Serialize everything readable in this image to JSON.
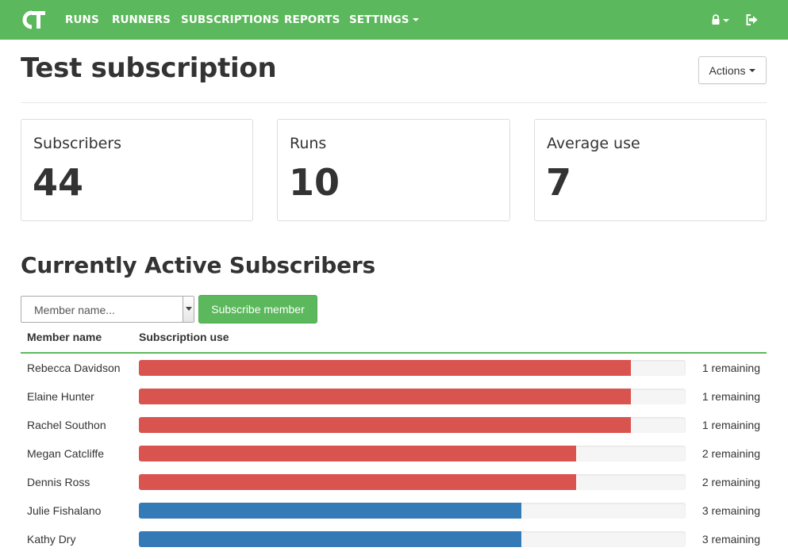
{
  "nav": {
    "items": [
      {
        "label": "RUNS"
      },
      {
        "label": "RUNNERS"
      },
      {
        "label": "SUBSCRIPTIONS"
      },
      {
        "label": "REPORTS"
      },
      {
        "label": "SETTINGS"
      }
    ],
    "accent_color": "#5cb85c",
    "right_icons": [
      "lock-icon",
      "sign-out-icon"
    ]
  },
  "page": {
    "title": "Test subscription",
    "actions_label": "Actions"
  },
  "stats": [
    {
      "label": "Subscribers",
      "value": "44"
    },
    {
      "label": "Runs",
      "value": "10"
    },
    {
      "label": "Average use",
      "value": "7"
    }
  ],
  "section": {
    "title": "Currently Active Subscribers",
    "select_placeholder": "Member name...",
    "subscribe_label": "Subscribe member"
  },
  "table": {
    "headers": [
      "Member name",
      "Subscription use"
    ],
    "colors": {
      "high": "#d9534f",
      "normal": "#337ab7"
    },
    "rows": [
      {
        "name": "Rebecca Davidson",
        "used": 9,
        "total": 10,
        "level": "high",
        "remaining": "1 remaining"
      },
      {
        "name": "Elaine Hunter",
        "used": 9,
        "total": 10,
        "level": "high",
        "remaining": "1 remaining"
      },
      {
        "name": "Rachel Southon",
        "used": 9,
        "total": 10,
        "level": "high",
        "remaining": "1 remaining"
      },
      {
        "name": "Megan Catcliffe",
        "used": 8,
        "total": 10,
        "level": "high",
        "remaining": "2 remaining"
      },
      {
        "name": "Dennis Ross",
        "used": 8,
        "total": 10,
        "level": "high",
        "remaining": "2 remaining"
      },
      {
        "name": "Julie Fishalano",
        "used": 7,
        "total": 10,
        "level": "normal",
        "remaining": "3 remaining"
      },
      {
        "name": "Kathy Dry",
        "used": 7,
        "total": 10,
        "level": "normal",
        "remaining": "3 remaining"
      }
    ]
  }
}
